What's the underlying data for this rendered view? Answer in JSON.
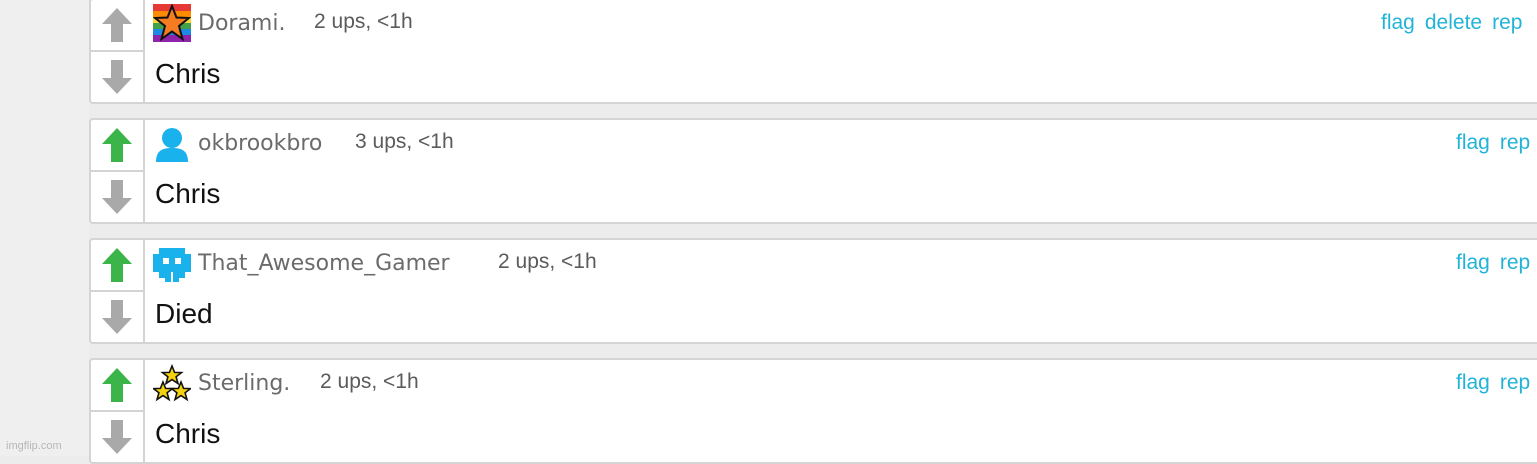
{
  "watermark": "imgflip.com",
  "colors": {
    "upvote_active": "#3bb54a",
    "vote_inactive": "#a9a9a9",
    "link": "#22b3d8",
    "username": "#6b6b6b",
    "avatar_blue": "#1ab2ec"
  },
  "comments": [
    {
      "username": "Dorami.",
      "meta": "2 ups, <1h",
      "text": "Chris",
      "avatar": "rainbow-star-icon",
      "upvoted": false,
      "actions": [
        "flag",
        "delete",
        "rep"
      ]
    },
    {
      "username": "okbrookbro",
      "meta": "3 ups, <1h",
      "text": "Chris",
      "avatar": "default-user-icon",
      "upvoted": true,
      "actions": [
        "flag",
        "rep"
      ]
    },
    {
      "username": "That_Awesome_Gamer",
      "meta": "2 ups, <1h",
      "text": "Died",
      "avatar": "space-invader-icon",
      "upvoted": true,
      "actions": [
        "flag",
        "rep"
      ]
    },
    {
      "username": "Sterling.",
      "meta": "2 ups, <1h",
      "text": "Chris",
      "avatar": "three-stars-icon",
      "upvoted": true,
      "actions": [
        "flag",
        "rep"
      ]
    }
  ]
}
